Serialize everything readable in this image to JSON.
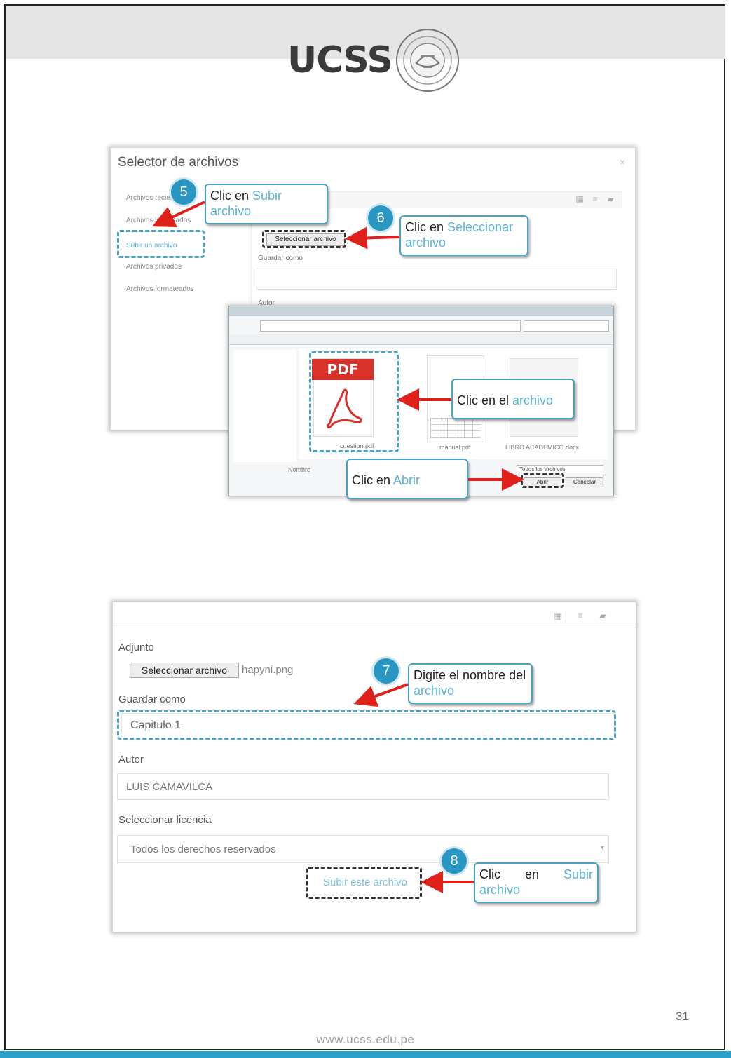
{
  "header": {
    "logo_text": "UCSS",
    "brand_color": "#2aa0c8"
  },
  "shot1": {
    "title": "Selector de archivos",
    "close": "×",
    "sidebar": [
      "Archivos recientes",
      "Archivos incrustados",
      "Subir un archivo",
      "Archivos privados",
      "Archivos formateados"
    ],
    "select_button": "Seleccionar archivo",
    "save_as_label": "Guardar como",
    "author_label": "Autor"
  },
  "open_dialog": {
    "pdf_label": "PDF",
    "file1": "cuestion.pdf",
    "file2": "manual.pdf",
    "file3": "LIBRO ACADEMICO.docx",
    "filename_label": "Nombre",
    "filter": "Todos los archivos",
    "open_button": "Abrir",
    "cancel_button": "Cancelar"
  },
  "callouts": {
    "c5": {
      "num": "5",
      "pre": "Clic en ",
      "hl": "Subir archivo"
    },
    "c6": {
      "num": "6",
      "pre": "Clic en ",
      "hl": "Seleccionar archivo"
    },
    "c_file": {
      "pre": "Clic en el ",
      "hl": "archivo"
    },
    "c_open": {
      "pre": "Clic en ",
      "hl": "Abrir"
    },
    "c7": {
      "num": "7",
      "pre": "Digite el nombre del ",
      "hl": "archivo"
    },
    "c8": {
      "num": "8",
      "pre": "Clic en ",
      "hl": "Subir archivo"
    }
  },
  "shot2": {
    "attachment_label": "Adjunto",
    "select_button": "Seleccionar archivo",
    "filename": "hapyni.png",
    "save_as_label": "Guardar como",
    "save_as_value": "Capitulo 1",
    "author_label": "Autor",
    "author_value": "LUIS CAMAVILCA",
    "license_label": "Seleccionar licencia",
    "license_value": "Todos los derechos reservados",
    "upload_button": "Subir este archivo"
  },
  "footer": {
    "page_number": "31",
    "url": "www.ucss.edu.pe"
  }
}
